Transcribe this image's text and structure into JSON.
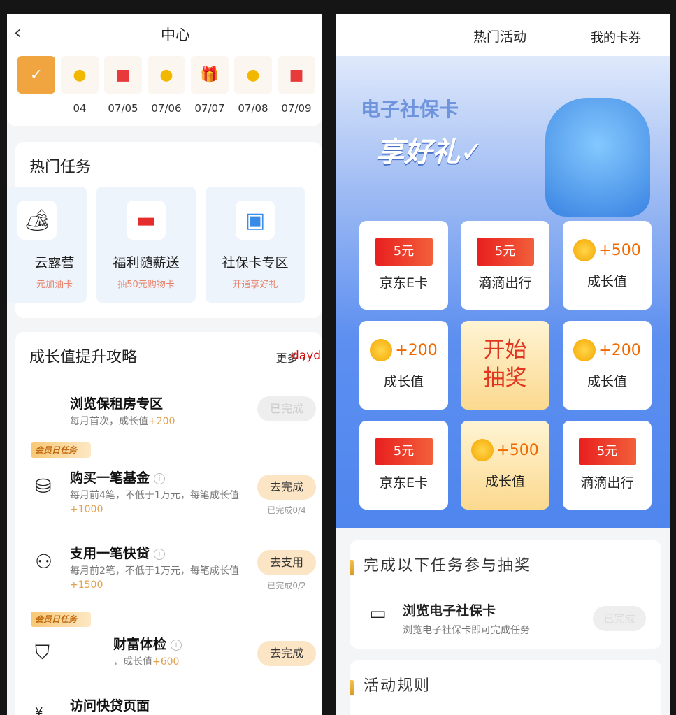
{
  "left": {
    "header": {
      "back": "‹",
      "title": "中心"
    },
    "dates": [
      {
        "label": "",
        "icon": "check-icon"
      },
      {
        "label": "04",
        "icon": "coin-icon"
      },
      {
        "label": "07/05",
        "icon": "gift-icon"
      },
      {
        "label": "07/06",
        "icon": "coin-icon"
      },
      {
        "label": "07/07",
        "icon": "gift-icon"
      },
      {
        "label": "07/08",
        "icon": "coin-icon"
      },
      {
        "label": "07/09",
        "icon": "gift-icon"
      }
    ],
    "hot": {
      "title": "热门任务",
      "tiles": [
        {
          "t": "云露营",
          "s": "元加油卡",
          "icon": "camp-icon"
        },
        {
          "t": "福利随薪送",
          "s": "抽50元购物卡",
          "icon": "wallet-icon"
        },
        {
          "t": "社保卡专区",
          "s": "开通享好礼",
          "icon": "card-icon"
        }
      ]
    },
    "growth": {
      "title": "成长值提升攻略",
      "more": "更多",
      "watermark": "daydayzhuan.com",
      "badge": "会员日任务",
      "tasks": [
        {
          "title": "浏览保租房专区",
          "desc": "每月首次，成长值",
          "plus": "+200",
          "btn": "已完成",
          "progress": ""
        },
        {
          "title": "购买一笔基金",
          "desc": "每月前4笔，不低于1万元，每笔成长值",
          "plus": "+1000",
          "btn": "去完成",
          "progress": "已完成0/4"
        },
        {
          "title": "支用一笔快贷",
          "desc": "每月前2笔，不低于1万元，每笔成长值",
          "plus": "+1500",
          "btn": "去支用",
          "progress": "已完成0/2"
        },
        {
          "title": "财富体检",
          "desc": "，成长值",
          "plus": "+600",
          "btn": "去完成",
          "progress": ""
        },
        {
          "title": "访问快贷页面",
          "desc": "",
          "plus": "",
          "btn": "",
          "progress": ""
        }
      ]
    }
  },
  "right": {
    "header": {
      "tab1": "热门活动",
      "tab2": "我的卡券"
    },
    "banner": {
      "title": "电子社保卡",
      "subtitle": "享好礼✓"
    },
    "grid": [
      {
        "type": "ticket",
        "value": "5元",
        "name": "京东E卡"
      },
      {
        "type": "ticket",
        "value": "5元",
        "name": "滴滴出行"
      },
      {
        "type": "coin",
        "value": "+500",
        "name": "成长值"
      },
      {
        "type": "coin",
        "value": "+200",
        "name": "成长值"
      },
      {
        "type": "draw",
        "value": "开始",
        "name": "抽奖"
      },
      {
        "type": "coin",
        "value": "+200",
        "name": "成长值"
      },
      {
        "type": "ticket",
        "value": "5元",
        "name": "京东E卡"
      },
      {
        "type": "coin",
        "value": "+500",
        "name": "成长值"
      },
      {
        "type": "ticket",
        "value": "5元",
        "name": "滴滴出行"
      }
    ],
    "tasks": {
      "title": "完成以下任务参与抽奖",
      "item": {
        "title": "浏览电子社保卡",
        "desc": "浏览电子社保卡即可完成任务",
        "btn": "已完成"
      }
    },
    "rules": {
      "title": "活动规则"
    }
  }
}
